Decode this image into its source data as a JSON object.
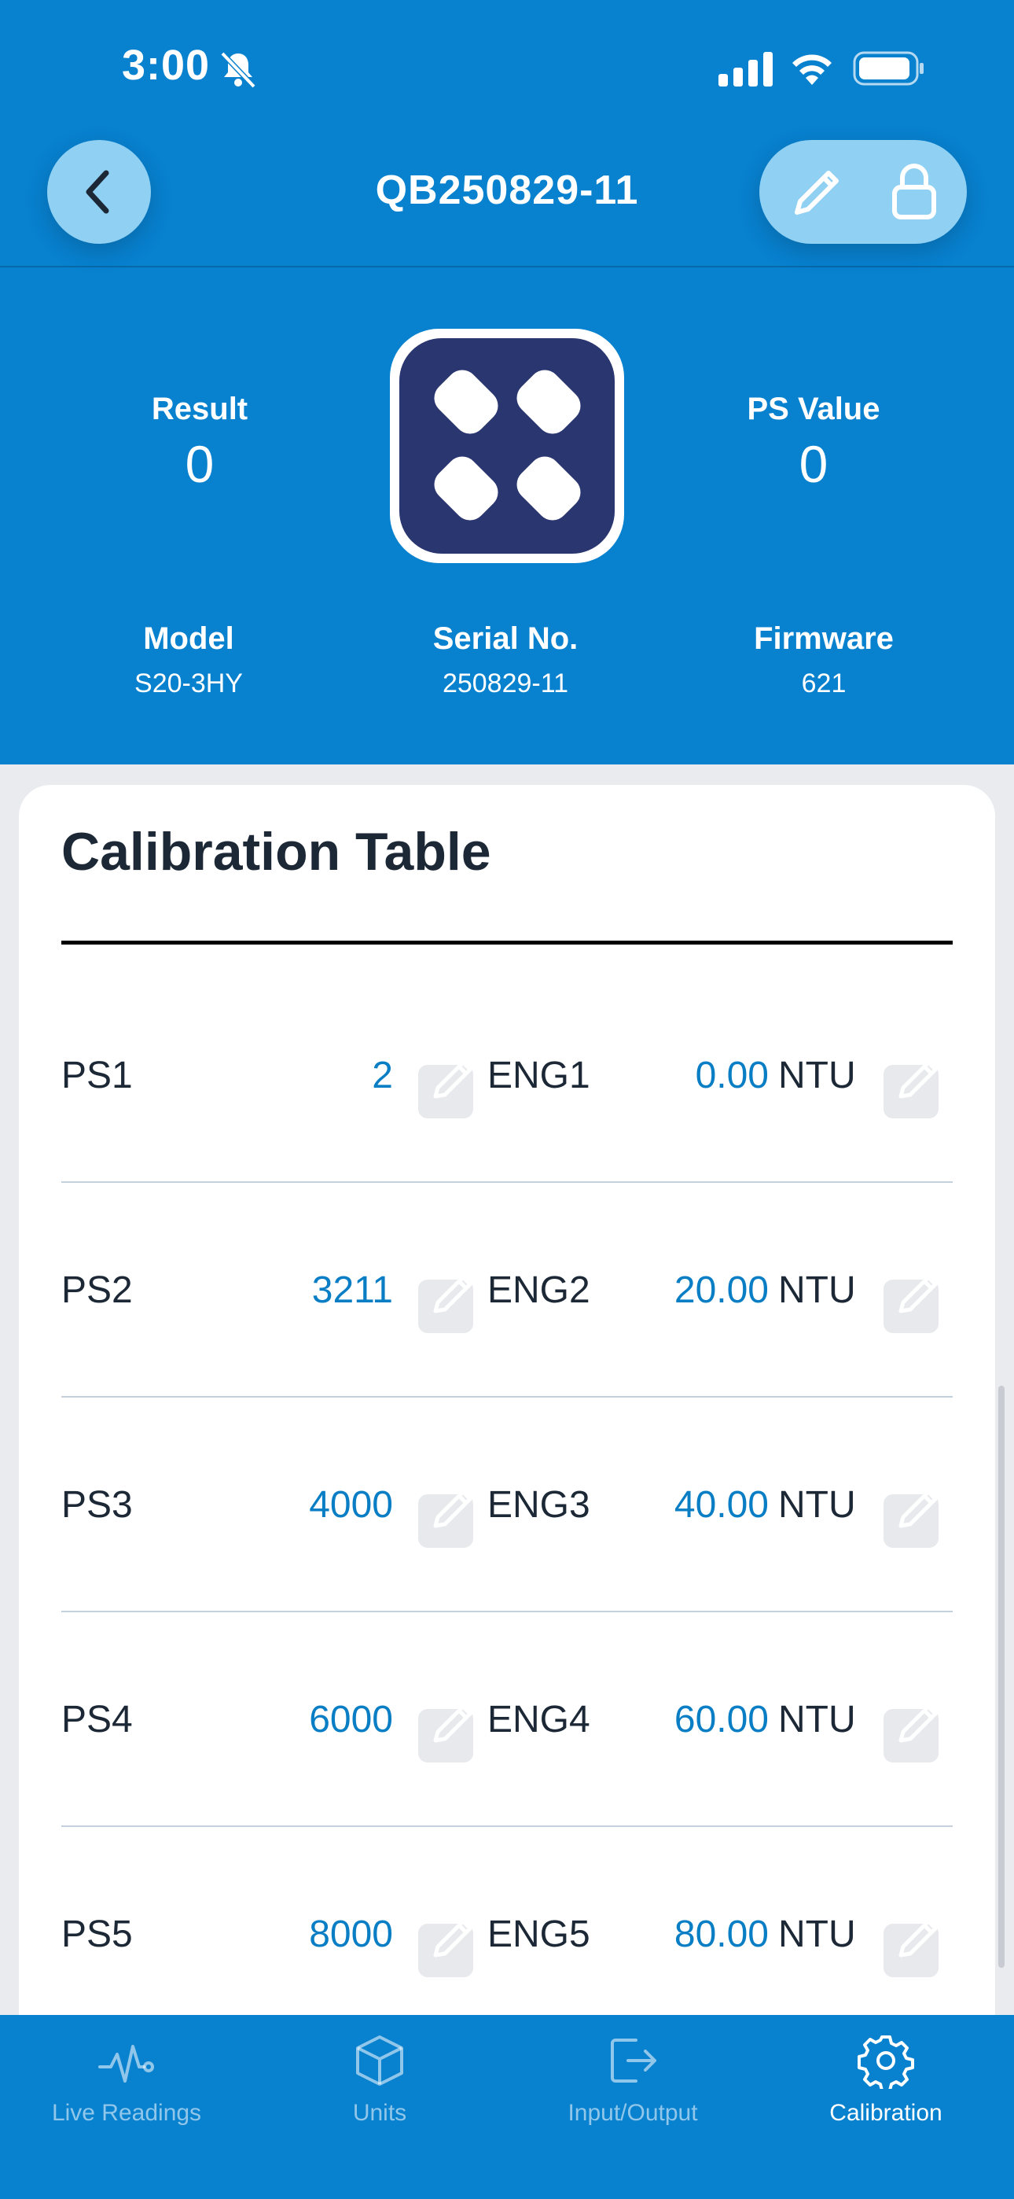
{
  "status_bar": {
    "time": "3:00"
  },
  "nav": {
    "title": "QB250829-11"
  },
  "header": {
    "result_label": "Result",
    "result_value": "0",
    "ps_value_label": "PS Value",
    "ps_value": "0",
    "model_label": "Model",
    "model_value": "S20-3HY",
    "serial_label": "Serial No.",
    "serial_value": "250829-11",
    "firmware_label": "Firmware",
    "firmware_value": "621"
  },
  "calibration": {
    "title": "Calibration Table",
    "rows": [
      {
        "ps_label": "PS1",
        "ps_value": "2",
        "eng_label": "ENG1",
        "eng_value": "0.00",
        "unit": "NTU"
      },
      {
        "ps_label": "PS2",
        "ps_value": "3211",
        "eng_label": "ENG2",
        "eng_value": "20.00",
        "unit": "NTU"
      },
      {
        "ps_label": "PS3",
        "ps_value": "4000",
        "eng_label": "ENG3",
        "eng_value": "40.00",
        "unit": "NTU"
      },
      {
        "ps_label": "PS4",
        "ps_value": "6000",
        "eng_label": "ENG4",
        "eng_value": "60.00",
        "unit": "NTU"
      },
      {
        "ps_label": "PS5",
        "ps_value": "8000",
        "eng_label": "ENG5",
        "eng_value": "80.00",
        "unit": "NTU"
      }
    ]
  },
  "tabs": [
    {
      "label": "Live Readings",
      "icon": "pulse-icon"
    },
    {
      "label": "Units",
      "icon": "cube-icon"
    },
    {
      "label": "Input/Output",
      "icon": "exit-icon"
    },
    {
      "label": "Calibration",
      "icon": "gear-icon",
      "active": true
    }
  ],
  "colors": {
    "brand_blue": "#0881cf",
    "value_blue": "#0a7ec4",
    "device_navy": "#2a3670"
  }
}
